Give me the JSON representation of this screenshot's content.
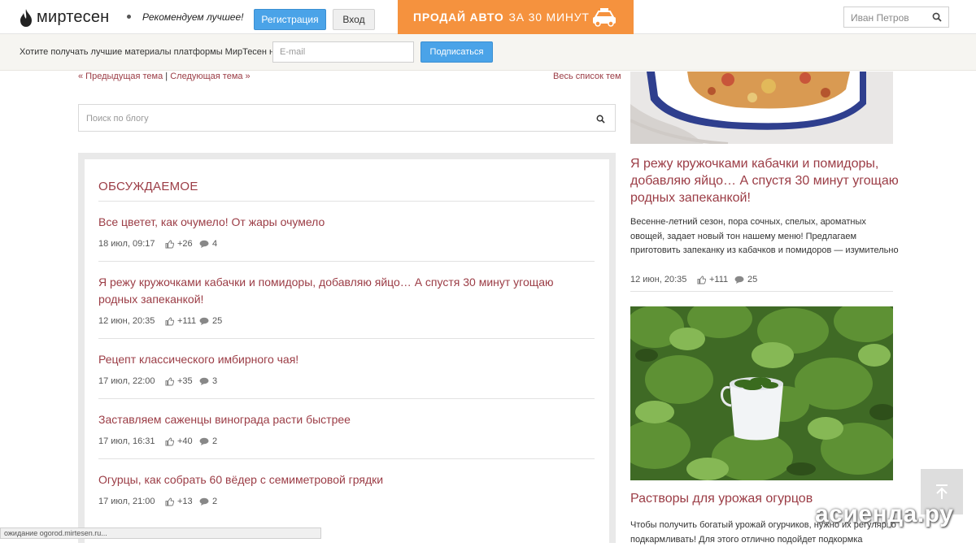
{
  "header": {
    "logo_text": "миртесен",
    "tagline": "Рекомендуем лучшее!",
    "register_label": "Регистрация",
    "login_label": "Вход",
    "ad_bold": "ПРОДАЙ АВТО",
    "ad_rest": "ЗА 30 МИНУТ",
    "user_search_placeholder": "Иван Петров"
  },
  "subscribe": {
    "text": "Хотите получать лучшие материалы платформы МирТесен на",
    "email_placeholder": "E-mail",
    "button_label": "Подписаться"
  },
  "nav": {
    "prev": "« Предыдущая тема",
    "separator": " | ",
    "next": "Следующая тема »",
    "all": "Весь список тем"
  },
  "blog_search": {
    "placeholder": "Поиск по блогу"
  },
  "discussed": {
    "title": "ОБСУЖДАЕМОЕ",
    "items": [
      {
        "title": "Все цветет, как очумело! От жары очумело",
        "date": "18 июл, 09:17",
        "likes": "+26",
        "comments": "4"
      },
      {
        "title": "Я режу кружочками кабачки и помидоры, добавляю яйцо… А спустя 30 минут угощаю родных запеканкой!",
        "date": "12 июн, 20:35",
        "likes": "+111",
        "comments": "25"
      },
      {
        "title": "Рецепт классического имбирного чая!",
        "date": "17 июл, 22:00",
        "likes": "+35",
        "comments": "3"
      },
      {
        "title": "Заставляем саженцы винограда расти быстрее",
        "date": "17 июл, 16:31",
        "likes": "+40",
        "comments": "2"
      },
      {
        "title": "Огурцы, как собрать 60 вёдер с семиметровой грядки",
        "date": "17 июл, 21:00",
        "likes": "+13",
        "comments": "2"
      }
    ]
  },
  "right": {
    "article1": {
      "title": "Я режу кружочками кабачки и помидоры, добавляю яйцо… А спустя 30 минут угощаю родных запеканкой!",
      "desc": "Весенне-летний сезон, пора сочных, спелых, ароматных овощей, задает новый тон нашему меню! Предлагаем приготовить запеканку из кабачков и помидоров — изумительно",
      "date": "12 июн, 20:35",
      "likes": "+111",
      "comments": "25"
    },
    "article2": {
      "title": "Растворы для урожая огурцов",
      "desc": "Чтобы получить богатый урожай огурчиков, нужно их регулярно подкармливать! Для этого отлично подойдет подкормка"
    }
  },
  "status_bar": "ожидание ogorod.mirtesen.ru...",
  "watermark": "асиенда.ру",
  "colors": {
    "accent": "#9b3c45",
    "button_blue": "#4aa3e8",
    "ad_orange": "#f5923e"
  }
}
